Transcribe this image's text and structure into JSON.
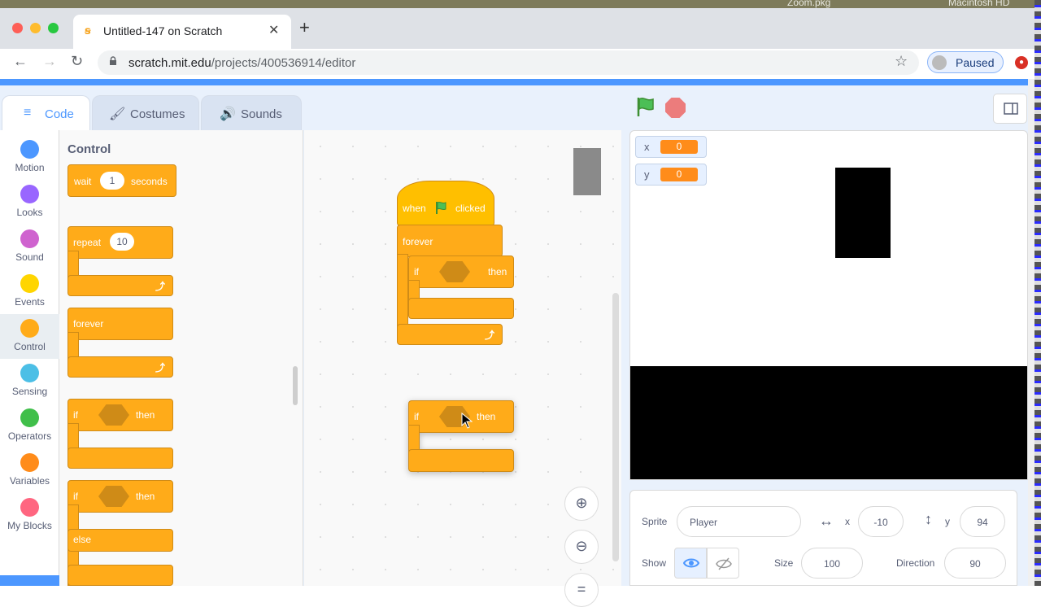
{
  "desktop": {
    "items": [
      "Zoom.pkg",
      "Macintosh HD"
    ]
  },
  "browser": {
    "tab_title": "Untitled-147 on Scratch",
    "url_host": "scratch.mit.edu",
    "url_path": "/projects/400536914/editor",
    "profile_status": "Paused"
  },
  "scratch": {
    "tabs": [
      "Code",
      "Costumes",
      "Sounds"
    ],
    "categories": [
      {
        "label": "Motion",
        "color": "#4c97ff"
      },
      {
        "label": "Looks",
        "color": "#9966ff"
      },
      {
        "label": "Sound",
        "color": "#cf63cf"
      },
      {
        "label": "Events",
        "color": "#ffd500"
      },
      {
        "label": "Control",
        "color": "#ffab19"
      },
      {
        "label": "Sensing",
        "color": "#4cbfe6"
      },
      {
        "label": "Operators",
        "color": "#40bf4a"
      },
      {
        "label": "Variables",
        "color": "#ff8c1a"
      },
      {
        "label": "My Blocks",
        "color": "#ff6680"
      }
    ],
    "selected_category": "Control",
    "palette": {
      "title": "Control",
      "wait": {
        "label": "wait",
        "value": "1",
        "suffix": "seconds"
      },
      "repeat": {
        "label": "repeat",
        "value": "10"
      },
      "forever": "forever",
      "if_label": "if",
      "then_label": "then",
      "else_label": "else"
    },
    "script": {
      "hat_when": "when",
      "hat_clicked": "clicked",
      "forever": "forever",
      "if": "if",
      "then": "then"
    },
    "loose_block": {
      "if": "if",
      "then": "then"
    },
    "monitors": [
      {
        "label": "x",
        "value": "0"
      },
      {
        "label": "y",
        "value": "0"
      }
    ],
    "sprite_info": {
      "sprite_label": "Sprite",
      "sprite_name": "Player",
      "x_label": "x",
      "x_value": "-10",
      "y_label": "y",
      "y_value": "94",
      "show_label": "Show",
      "size_label": "Size",
      "size_value": "100",
      "direction_label": "Direction",
      "direction_value": "90"
    }
  }
}
